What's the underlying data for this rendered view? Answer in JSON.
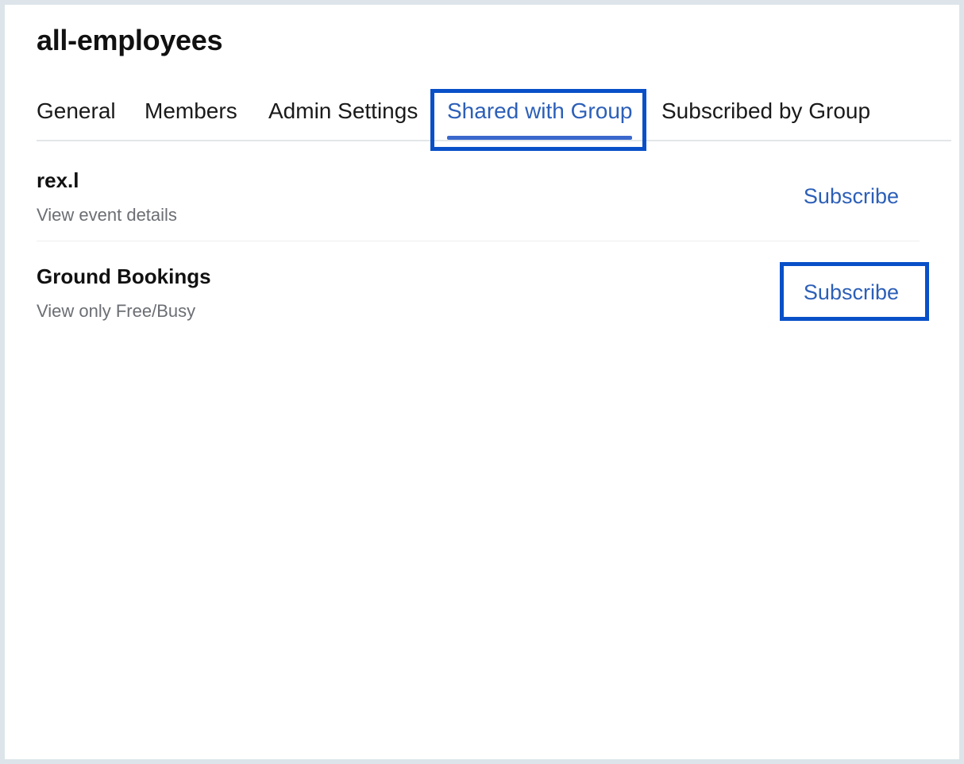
{
  "group": {
    "title": "all-employees"
  },
  "tabs": [
    {
      "label": "General",
      "active": false
    },
    {
      "label": "Members",
      "active": false
    },
    {
      "label": "Admin Settings",
      "active": false
    },
    {
      "label": "Shared with Group",
      "active": true
    },
    {
      "label": "Subscribed by Group",
      "active": false
    }
  ],
  "calendars": [
    {
      "name": "rex.l",
      "permission": "View event details",
      "action": "Subscribe"
    },
    {
      "name": "Ground Bookings",
      "permission": "View only Free/Busy",
      "action": "Subscribe"
    }
  ],
  "colors": {
    "accent": "#2c5fb8",
    "highlight": "#0950c8",
    "muted_text": "#6b6e73"
  }
}
